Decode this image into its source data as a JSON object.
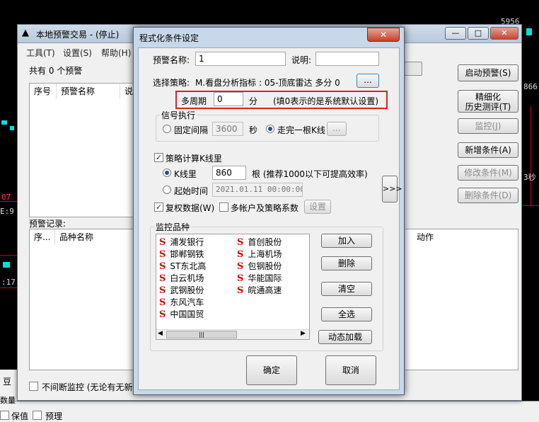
{
  "background": {
    "texts": [
      "5956",
      "866",
      "3秒",
      "07",
      "E:9",
      ":17",
      "豆",
      "数量",
      "保值",
      "预理"
    ]
  },
  "back_window": {
    "title": "本地预警交易 - (停止)",
    "controls": {
      "min": "—",
      "max": "□",
      "close": "✕"
    },
    "menu": [
      "工具(T)",
      "设置(S)",
      "帮助(H)"
    ],
    "count_text": "共有 0 个预警",
    "list_columns": [
      "序号",
      "预警名称",
      "说"
    ],
    "log_label": "预警记录:",
    "log_columns": [
      "序...",
      "品种名称",
      "动作"
    ],
    "buttons": [
      {
        "label": "启动预警(S)",
        "enabled": true
      },
      {
        "label": "精细化\n历史测评(T)",
        "enabled": true
      },
      {
        "label": "监控(J)",
        "enabled": false
      },
      {
        "label": "新增条件(A)",
        "enabled": true
      },
      {
        "label": "修改条件(M)",
        "enabled": false
      },
      {
        "label": "删除条件(D)",
        "enabled": false
      }
    ],
    "continuous_monitor": "不间断监控 (无论有无新行"
  },
  "dialog": {
    "title": "程式化条件设定",
    "close": "✕",
    "alert_name_label": "预警名称:",
    "alert_name_value": "1",
    "desc_label": "说明:",
    "desc_value": "",
    "strategy_label": "选择策略:",
    "strategy_value": "M.看盘分析指标 : 05-顶底雷达 多分 0",
    "strategy_btn": "...",
    "multi_period_label": "多周期",
    "multi_period_value": "0",
    "multi_period_unit": "分",
    "multi_period_hint": "(填0表示的是系统默认设置)",
    "signal_group": "信号执行",
    "fixed_interval_label": "固定间隔",
    "fixed_interval_value": "3600",
    "sec_label": "秒",
    "kline_label": "走完一根K线",
    "kline_btn": "...",
    "calc_kline_label": "策略计算K线里",
    "kline_count_label": "K线里",
    "kline_count_value": "860",
    "kline_count_unit": "根 (推荐1000以下可提高效率)",
    "start_time_label": "起始时间",
    "start_time_value": "2021.01.11 00:00:00",
    "expand_btn": ">>>",
    "rights_label": "复权数据(W)",
    "multi_account_label": "多帐户及策略系数",
    "settings_btn": "设置",
    "monitor_group": "监控品种",
    "stocks_col1": [
      "浦发银行",
      "邯郸钢铁",
      "ST东北高",
      "白云机场",
      "武钢股份",
      "东风汽车",
      "中国国贸"
    ],
    "stocks_col2": [
      "首创股份",
      "上海机场",
      "包钢股份",
      "华能国际",
      "皖通高速"
    ],
    "stock_marker": "S",
    "scroll_thumb": "|||",
    "side_buttons": [
      "加入",
      "删除",
      "清空",
      "全选",
      "动态加载"
    ],
    "ok": "确定",
    "cancel": "取消"
  }
}
